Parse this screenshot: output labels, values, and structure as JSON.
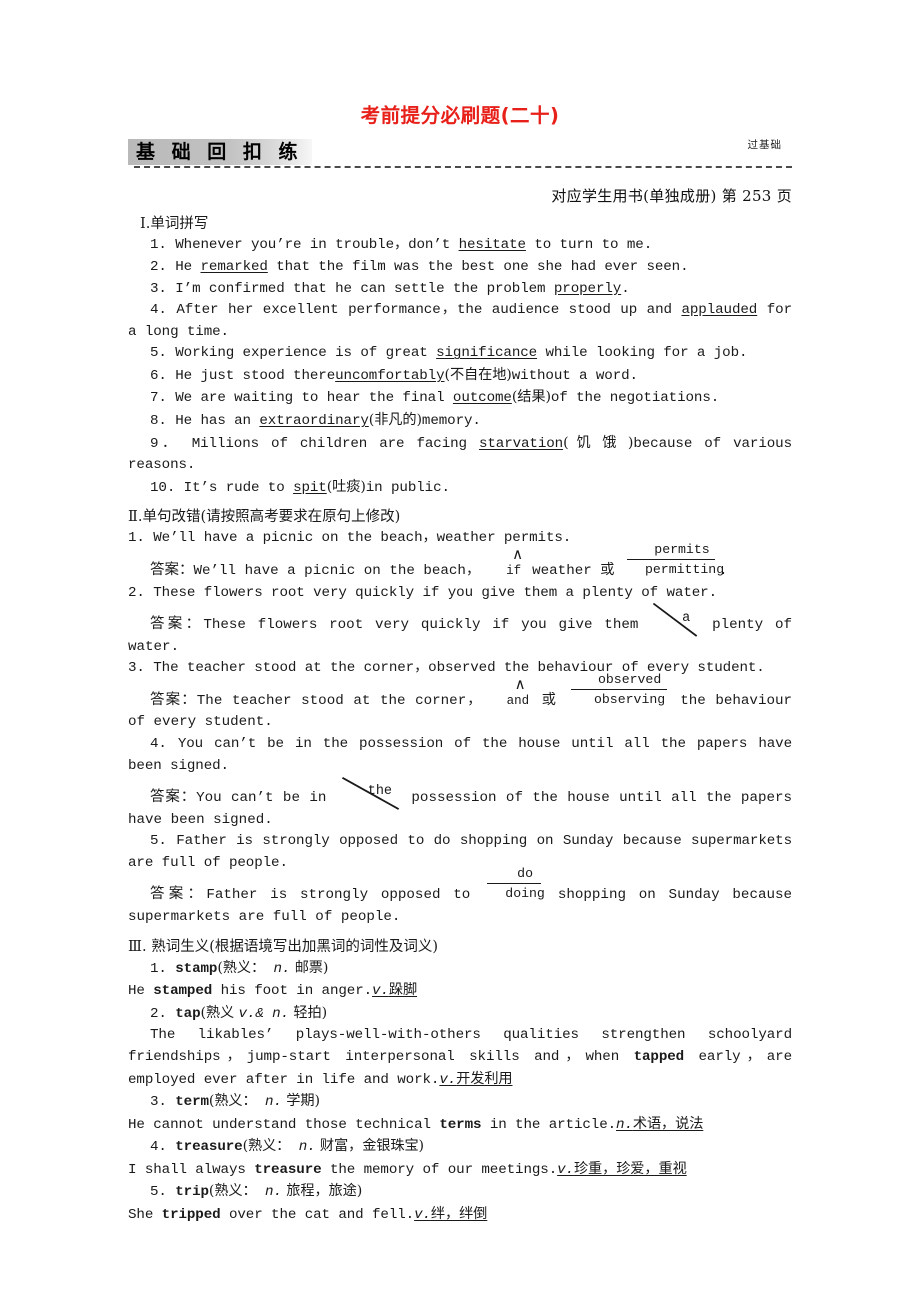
{
  "header": {
    "title": "考前提分必刷题(二十)",
    "banner_label": "基 础 回 扣 练",
    "banner_tag": "过基础",
    "book_note": "对应学生用书(单独成册) 第 253 页",
    "title_color": "#e8201a"
  },
  "section1": {
    "heading": "Ⅰ.单词拼写",
    "items": [
      {
        "no": "1.",
        "pre": "Whenever you’re in trouble，don’t ",
        "answer": "hesitate",
        "post": " to turn to me."
      },
      {
        "no": "2.",
        "pre": "He ",
        "answer": "remarked",
        "post": " that the film was the best one she had ever seen."
      },
      {
        "no": "3.",
        "pre": "I’m confirmed that he can settle the problem ",
        "answer": "properly",
        "post": "."
      },
      {
        "no": "4.",
        "pre": "After her excellent performance，the audience stood up and ",
        "answer": "applauded",
        "post": " for a long time."
      },
      {
        "no": "5.",
        "pre": "Working experience is of great ",
        "answer": "significance",
        "post": " while looking for a job."
      },
      {
        "no": "6.",
        "pre": "He just stood there",
        "answer": "uncomfortably",
        "gloss": "(不自在地)",
        "post": "without a word."
      },
      {
        "no": "7.",
        "pre": "We are waiting to hear the final ",
        "answer": "outcome",
        "gloss": "(结果)",
        "post": "of the negotiations."
      },
      {
        "no": "8.",
        "pre": "He has an ",
        "answer": "extraordinary",
        "gloss": "(非凡的)",
        "post": "memory."
      },
      {
        "no": "9．",
        "pre": "Millions of children are facing ",
        "answer": "starvation",
        "gloss": "( 饥 饿 )",
        "post": "because of various reasons."
      },
      {
        "no": "10.",
        "pre": "It’s rude to ",
        "answer": "spit",
        "gloss": "(吐痰)",
        "post": "in public."
      }
    ]
  },
  "section2": {
    "heading": "Ⅱ.单句改错(请按照高考要求在原句上修改)",
    "answer_label": "答案：",
    "or_label": "或",
    "items": [
      {
        "no": "1.",
        "question": "We’ll have a picnic on the beach，weather permits.",
        "answer_pre": "We’ll have a picnic on the beach，",
        "insert_caret": "∧",
        "insert_word": "if",
        "answer_mid": "weather ",
        "frac_num": "permits",
        "frac_den": "permitting",
        "answer_post": "."
      },
      {
        "no": "2.",
        "question": "These flowers root very quickly if you give them a plenty of water.",
        "answer_pre": "These flowers root very quickly if you give them ",
        "deleted": "a",
        "answer_post": " plenty of water."
      },
      {
        "no": "3.",
        "question": "The teacher stood at the corner，observed the behaviour of every student.",
        "answer_pre": "The teacher stood at the corner，",
        "insert_caret": "∧",
        "insert_word": "and",
        "answer_mid": "",
        "frac_num": "observed",
        "frac_den": "observing",
        "answer_post": " the behaviour of every student."
      },
      {
        "no": "4.",
        "question": "You can’t be in the possession of the house until all the papers have been signed.",
        "answer_pre": "You can’t be in ",
        "deleted": "the",
        "answer_post": " possession of the house until all the papers have been signed."
      },
      {
        "no": "5.",
        "question": "Father is strongly opposed to do shopping on Sunday because supermarkets are full of people.",
        "answer_pre": "Father is strongly opposed to ",
        "frac_num": "do",
        "frac_den": "doing",
        "answer_post": " shopping on Sunday because supermarkets are full of people."
      }
    ]
  },
  "section3": {
    "heading": "Ⅲ. 熟词生义(根据语境写出加黑词的词性及词义)",
    "items": [
      {
        "no": "1.",
        "word": "stamp",
        "known": "(熟义：",
        "known_pos": "n.",
        "known_sense": " 邮票)",
        "sent_pre": "He ",
        "sent_bold": "stamped",
        "sent_post": " his foot in anger.",
        "ans_pos": "v.",
        "ans_sense": "跺脚"
      },
      {
        "no": "2.",
        "word": "tap",
        "known": "(熟义 ",
        "known_pos": "v.& n.",
        "known_sense": " 轻拍)",
        "sent_pre": "The likables’ plays-well-with-others qualities strengthen schoolyard friendships，jump-start interpersonal skills and，when ",
        "sent_bold": "tapped",
        "sent_post": " early，are employed ever after in life and work.",
        "ans_pos": "v.",
        "ans_sense": "开发利用"
      },
      {
        "no": "3.",
        "word": "term",
        "known": "(熟义：",
        "known_pos": "n.",
        "known_sense": " 学期)",
        "sent_pre": "He cannot understand those technical ",
        "sent_bold": "terms",
        "sent_post": " in the article.",
        "ans_pos": "n.",
        "ans_sense": "术语，说法"
      },
      {
        "no": "4.",
        "word": "treasure",
        "known": "(熟义：",
        "known_pos": "n.",
        "known_sense": " 财富，金银珠宝)",
        "sent_pre": "I shall always ",
        "sent_bold": "treasure",
        "sent_post": " the memory of our meetings.",
        "ans_pos": "v.",
        "ans_sense": "珍重，珍爱，重视"
      },
      {
        "no": "5.",
        "word": "trip",
        "known": "(熟义：",
        "known_pos": "n.",
        "known_sense": " 旅程，旅途)",
        "sent_pre": "She ",
        "sent_bold": "tripped",
        "sent_post": " over the cat and fell.",
        "ans_pos": "v.",
        "ans_sense": "绊，绊倒"
      }
    ]
  }
}
